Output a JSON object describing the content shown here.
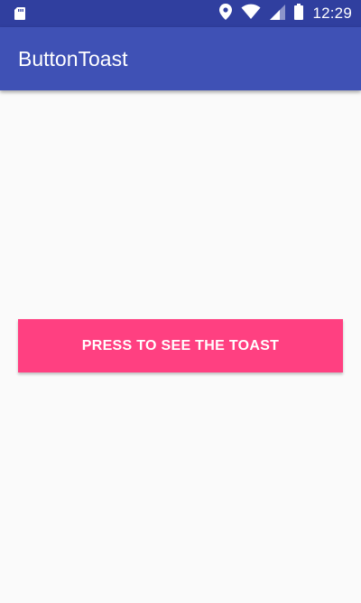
{
  "status_bar": {
    "time": "12:29",
    "icons": [
      "sd-card-icon",
      "location-icon",
      "wifi-icon",
      "cell-signal-icon",
      "battery-icon"
    ],
    "background_color": "#303f9f"
  },
  "app_bar": {
    "title": "ButtonToast",
    "background_color": "#3f51b5"
  },
  "main": {
    "button_label": "PRESS TO SEE THE TOAST",
    "button_color": "#ff4081"
  }
}
